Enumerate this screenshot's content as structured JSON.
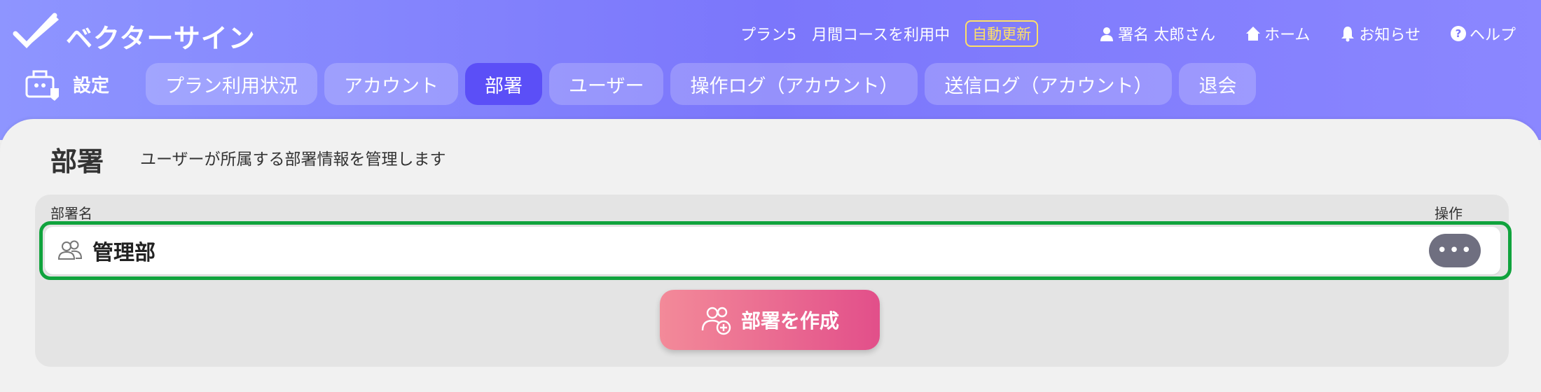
{
  "app": {
    "logo_text": "ベクターサイン"
  },
  "topnav": {
    "plan": "プラン5　月間コースを利用中",
    "auto_renew": "自動更新",
    "user": "署名 太郎さん",
    "home": "ホーム",
    "notice": "お知らせ",
    "help": "ヘルプ"
  },
  "settings": {
    "label": "設定"
  },
  "tabs": [
    {
      "label": "プラン利用状況",
      "active": false
    },
    {
      "label": "アカウント",
      "active": false
    },
    {
      "label": "部署",
      "active": true
    },
    {
      "label": "ユーザー",
      "active": false
    },
    {
      "label": "操作ログ（アカウント）",
      "active": false
    },
    {
      "label": "送信ログ（アカウント）",
      "active": false
    },
    {
      "label": "退会",
      "active": false
    }
  ],
  "page": {
    "title": "部署",
    "description": "ユーザーが所属する部署情報を管理します"
  },
  "table": {
    "col_name": "部署名",
    "col_op": "操作",
    "rows": [
      {
        "name": "管理部"
      }
    ],
    "more_label": "•••"
  },
  "create_button": {
    "label": "部署を作成"
  },
  "colors": {
    "header_start": "#8e95ff",
    "tab_active": "#5b4ff7",
    "highlight": "#10a33d",
    "create_start": "#f38a99",
    "create_end": "#e24f8a"
  }
}
